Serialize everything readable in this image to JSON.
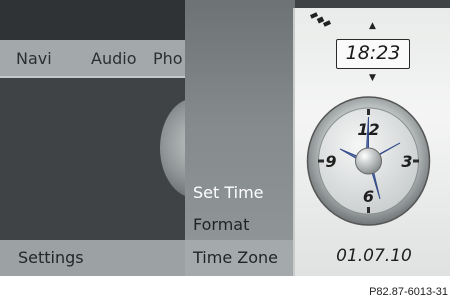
{
  "menu": {
    "items": [
      "Navi",
      "Audio",
      "Pho"
    ]
  },
  "settings_label": "Settings",
  "submenu": {
    "items": [
      "Set Time",
      "Format",
      "Time Zone"
    ],
    "selected_index": 0
  },
  "clock_panel": {
    "time": "18:23",
    "date": "01.07.10",
    "dial_numbers": [
      "12",
      "3",
      "6",
      "9"
    ],
    "gps_icon": "satellite-icon",
    "up_arrow_icon": "arrow-up-icon",
    "down_arrow_icon": "arrow-down-icon"
  },
  "figure_caption": "P82.87-6013-31",
  "colors": {
    "screen_dark": "#3e4244",
    "menu_bar": "#a3a9ab",
    "panel_bg": "#eef0ef",
    "selected_text": "#ffffff",
    "clock_hands": "#5c76b8"
  }
}
